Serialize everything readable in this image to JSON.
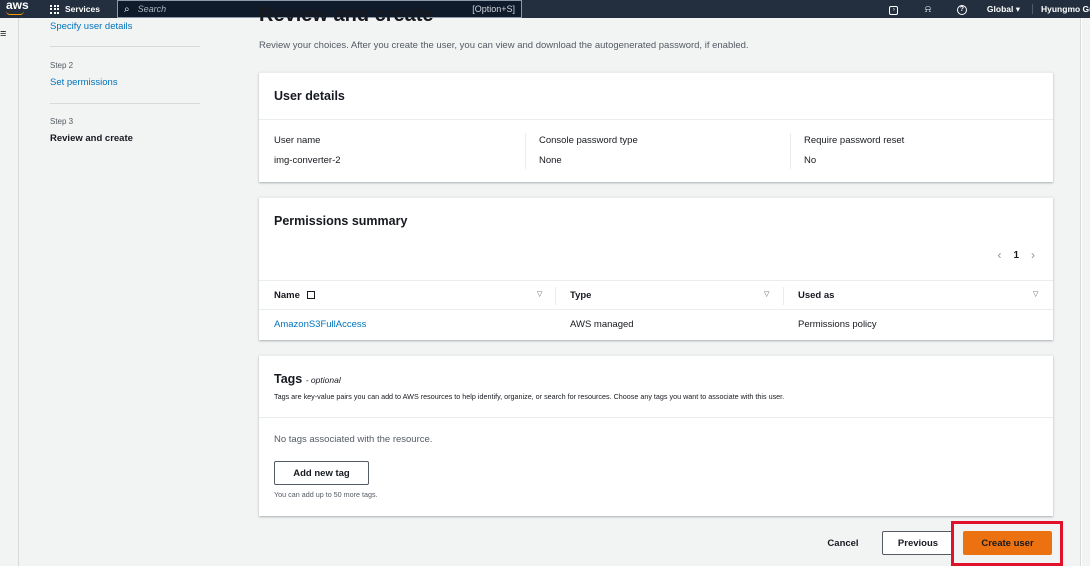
{
  "topnav": {
    "logo": "aws",
    "services_label": "Services",
    "search_placeholder": "Search",
    "search_shortcut": "[Option+S]",
    "icons": [
      "cloudshell-icon",
      "bell-icon",
      "help-icon"
    ],
    "region": "Global ▾",
    "user": "Hyungmo Gu"
  },
  "wizard": {
    "step1_link": "Specify user details",
    "step2_caption": "Step 2",
    "step2_title": "Set permissions",
    "step3_caption": "Step 3",
    "step3_title": "Review and create"
  },
  "main": {
    "title": "Review and create",
    "description": "Review your choices. After you create the user, you can view and download the autogenerated password, if enabled."
  },
  "user_details": {
    "heading": "User details",
    "user_name_label": "User name",
    "user_name_value": "img-converter-2",
    "console_password_label": "Console password type",
    "console_password_value": "None",
    "reset_label": "Require password reset",
    "reset_value": "No"
  },
  "permissions": {
    "heading": "Permissions summary",
    "page": "1",
    "columns": [
      "Name",
      "Type",
      "Used as"
    ],
    "rows": [
      {
        "name": "AmazonS3FullAccess",
        "type": "AWS managed",
        "used_as": "Permissions policy"
      }
    ]
  },
  "tags": {
    "heading": "Tags",
    "optional": "- optional",
    "description": "Tags are key-value pairs you can add to AWS resources to help identify, organize, or search for resources. Choose any tags you want to associate with this user.",
    "empty": "No tags associated with the resource.",
    "add_button": "Add new tag",
    "limit_hint": "You can add up to 50 more tags."
  },
  "footer": {
    "cancel": "Cancel",
    "previous": "Previous",
    "create": "Create user"
  },
  "colors": {
    "nav_bg": "#232f3e",
    "link": "#0073bb",
    "primary": "#ec7211",
    "highlight": "#e0112b"
  }
}
